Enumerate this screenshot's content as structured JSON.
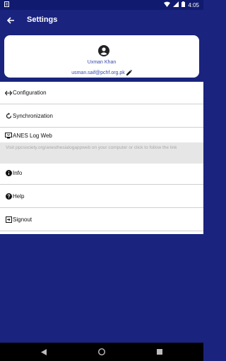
{
  "status_bar": {
    "time": "4:05",
    "icons": [
      "notification-icon",
      "wifi-icon",
      "signal-icon",
      "battery-icon"
    ]
  },
  "app_bar": {
    "title": "Settings",
    "back_icon": "arrow-back-icon"
  },
  "profile": {
    "name": "Uxman Khan",
    "email": "usman.saif@pchf.org.pk",
    "avatar_icon": "account-circle-icon",
    "edit_icon": "pencil-icon"
  },
  "menu": {
    "items": [
      {
        "label": "Configuration",
        "icon": "swap-arrows-icon"
      },
      {
        "label": "Synchronization",
        "icon": "sync-icon"
      },
      {
        "label": "ANES Log Web",
        "icon": "monitor-icon"
      },
      {
        "label": "Info",
        "icon": "info-icon"
      },
      {
        "label": "Help",
        "icon": "help-icon"
      },
      {
        "label": "Signout",
        "icon": "exit-icon"
      }
    ],
    "log_hint": "Visit ppcsociety.org/anesthesialogappweb on your computer or click to follow the link"
  },
  "nav_bar": {
    "icons": [
      "back-triangle-icon",
      "home-circle-icon",
      "recents-square-icon"
    ]
  },
  "colors": {
    "primary": "#1a237e",
    "status_bar": "#101a6e",
    "accent_text": "#3949ab"
  }
}
